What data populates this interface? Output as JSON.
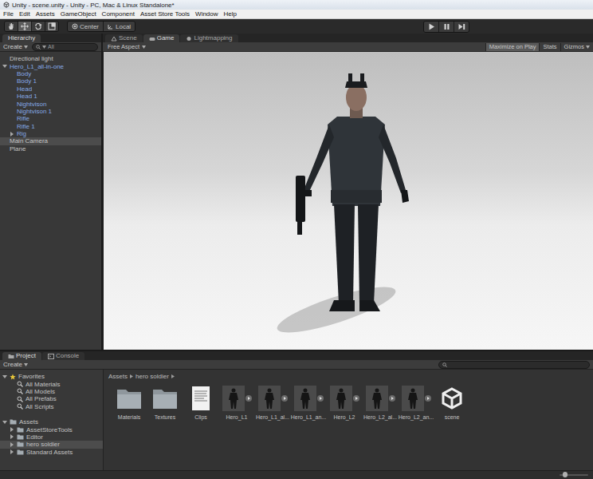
{
  "window": {
    "title": "Unity - scene.unity - Unity - PC, Mac & Linux Standalone*"
  },
  "menu": [
    "File",
    "Edit",
    "Assets",
    "GameObject",
    "Component",
    "Asset Store Tools",
    "Window",
    "Help"
  ],
  "toolbar": {
    "tools": [
      {
        "kind": "hand",
        "selected": false
      },
      {
        "kind": "move",
        "selected": true
      },
      {
        "kind": "rotate",
        "selected": false
      },
      {
        "kind": "scale",
        "selected": false
      }
    ],
    "pivot": [
      {
        "label": "Center",
        "kind": "center"
      },
      {
        "label": "Local",
        "kind": "local"
      }
    ],
    "playback": [
      {
        "kind": "play",
        "on": false
      },
      {
        "kind": "pause",
        "on": false
      },
      {
        "kind": "step",
        "on": false
      }
    ]
  },
  "hierarchy": {
    "tabs": [
      {
        "label": "Hierarchy",
        "selected": true
      }
    ],
    "create": "Create",
    "search": "All",
    "items": [
      {
        "label": "Directional light",
        "depth": 0,
        "prefab": false,
        "has_children": false,
        "expanded": false,
        "selected": false
      },
      {
        "label": "Hero_L1_all-in-one",
        "depth": 0,
        "prefab": true,
        "has_children": true,
        "expanded": true,
        "selected": false
      },
      {
        "label": "Body",
        "depth": 1,
        "prefab": true,
        "has_children": false,
        "expanded": false,
        "selected": false
      },
      {
        "label": "Body 1",
        "depth": 1,
        "prefab": true,
        "has_children": false,
        "expanded": false,
        "selected": false
      },
      {
        "label": "Head",
        "depth": 1,
        "prefab": true,
        "has_children": false,
        "expanded": false,
        "selected": false
      },
      {
        "label": "Head 1",
        "depth": 1,
        "prefab": true,
        "has_children": false,
        "expanded": false,
        "selected": false
      },
      {
        "label": "Nightvison",
        "depth": 1,
        "prefab": true,
        "has_children": false,
        "expanded": false,
        "selected": false
      },
      {
        "label": "Nightvison 1",
        "depth": 1,
        "prefab": true,
        "has_children": false,
        "expanded": false,
        "selected": false
      },
      {
        "label": "Rifle",
        "depth": 1,
        "prefab": true,
        "has_children": false,
        "expanded": false,
        "selected": false
      },
      {
        "label": "Rifle 1",
        "depth": 1,
        "prefab": true,
        "has_children": false,
        "expanded": false,
        "selected": false
      },
      {
        "label": "Rig",
        "depth": 1,
        "prefab": true,
        "has_children": true,
        "expanded": false,
        "selected": false
      },
      {
        "label": "Main Camera",
        "depth": 0,
        "prefab": false,
        "has_children": false,
        "expanded": false,
        "selected": true
      },
      {
        "label": "Plane",
        "depth": 0,
        "prefab": false,
        "has_children": false,
        "expanded": false,
        "selected": false
      }
    ]
  },
  "game": {
    "tabs": [
      {
        "label": "Scene",
        "kind": "scene",
        "selected": false
      },
      {
        "label": "Game",
        "kind": "game",
        "selected": true
      },
      {
        "label": "Lightmapping",
        "kind": "lightmapping",
        "selected": false
      }
    ],
    "aspect": "Free Aspect",
    "toggles": [
      {
        "label": "Maximize on Play",
        "on": true,
        "dropdown": false
      },
      {
        "label": "Stats",
        "on": false,
        "dropdown": false
      },
      {
        "label": "Gizmos",
        "on": false,
        "dropdown": true
      }
    ]
  },
  "project": {
    "tabs": [
      {
        "label": "Project",
        "kind": "project",
        "selected": true
      },
      {
        "label": "Console",
        "kind": "console",
        "selected": false
      }
    ],
    "create": "Create",
    "tree": [
      {
        "label": "Favorites",
        "kind": "favorites",
        "depth": 0,
        "has_children": true,
        "expanded": true,
        "selected": false
      },
      {
        "label": "All Materials",
        "kind": "search",
        "depth": 1,
        "has_children": false,
        "expanded": false,
        "selected": false
      },
      {
        "label": "All Models",
        "kind": "search",
        "depth": 1,
        "has_children": false,
        "expanded": false,
        "selected": false
      },
      {
        "label": "All Prefabs",
        "kind": "search",
        "depth": 1,
        "has_children": false,
        "expanded": false,
        "selected": false
      },
      {
        "label": "All Scripts",
        "kind": "search",
        "depth": 1,
        "has_children": false,
        "expanded": false,
        "selected": false
      },
      {
        "label": "Assets",
        "kind": "folder",
        "depth": 0,
        "has_children": true,
        "expanded": true,
        "selected": false
      },
      {
        "label": "AssetStoreTools",
        "kind": "folder",
        "depth": 1,
        "has_children": true,
        "expanded": false,
        "selected": false
      },
      {
        "label": "Editor",
        "kind": "folder",
        "depth": 1,
        "has_children": true,
        "expanded": false,
        "selected": false
      },
      {
        "label": "hero soldier",
        "kind": "folder",
        "depth": 1,
        "has_children": true,
        "expanded": false,
        "selected": true
      },
      {
        "label": "Standard Assets",
        "kind": "folder",
        "depth": 1,
        "has_children": true,
        "expanded": false,
        "selected": false
      }
    ],
    "breadcrumb": [
      "Assets",
      "hero soldier"
    ],
    "files": [
      {
        "label": "Materials",
        "kind": "folder"
      },
      {
        "label": "Textures",
        "kind": "folder"
      },
      {
        "label": "Clips",
        "kind": "document"
      },
      {
        "label": "Hero_L1",
        "kind": "model"
      },
      {
        "label": "Hero_L1_al...",
        "kind": "model"
      },
      {
        "label": "Hero_L1_an...",
        "kind": "model"
      },
      {
        "label": "Hero_L2",
        "kind": "model"
      },
      {
        "label": "Hero_L2_al...",
        "kind": "model"
      },
      {
        "label": "Hero_L2_an...",
        "kind": "model"
      },
      {
        "label": "scene",
        "kind": "scene"
      }
    ],
    "zoom": {
      "level": 0.2
    }
  }
}
